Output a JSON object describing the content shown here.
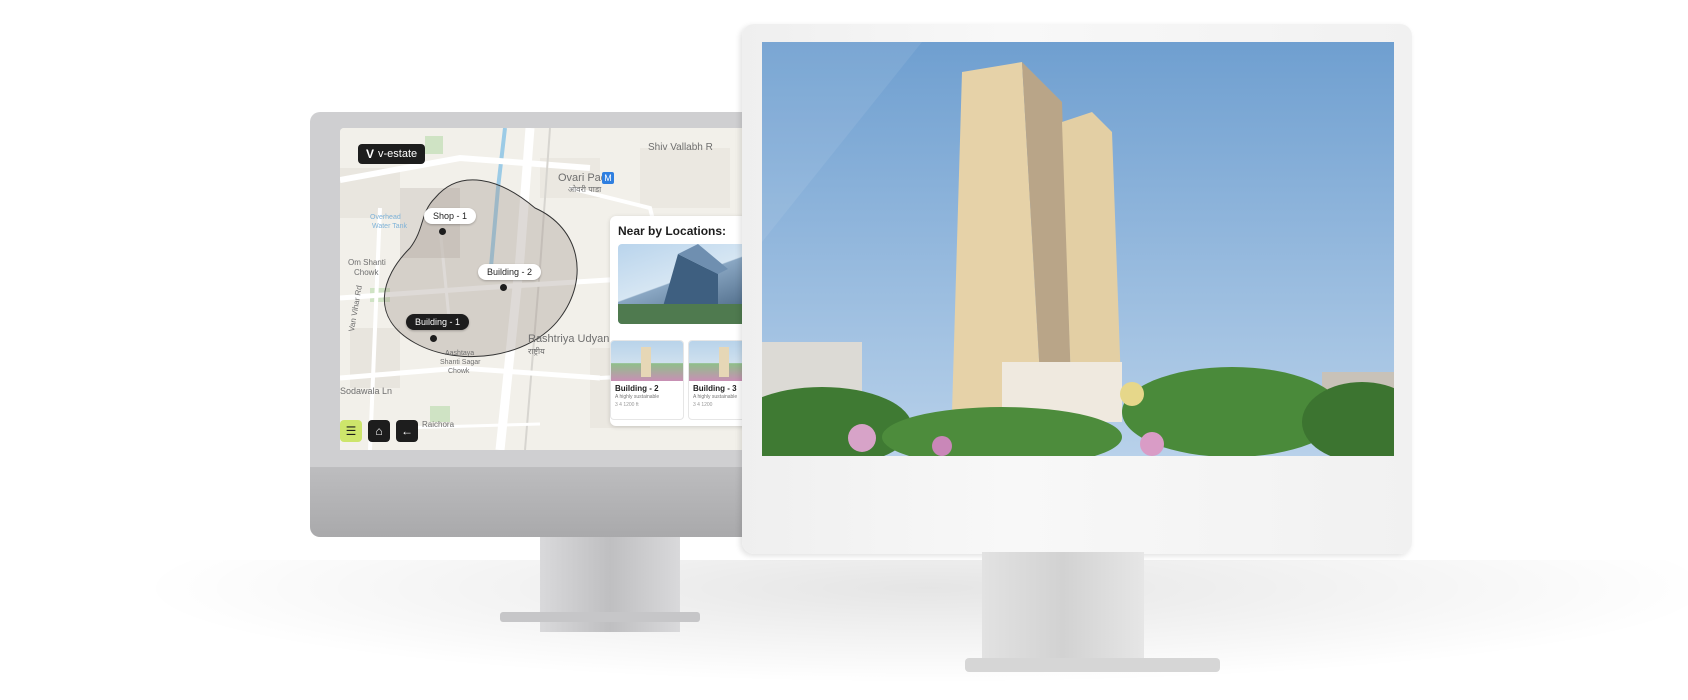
{
  "brand": {
    "logo_mark": "V",
    "name": "v-estate"
  },
  "map": {
    "labels": {
      "shiv_vallabh": "Shiv Vallabh R",
      "ovari_pada": "Ovari Pada",
      "ovari_pada_hindi": "ओवरी पाडा",
      "metro_marker": "M",
      "om_shanti": "Om Shanti",
      "om_shanti_chowk": "Chowk",
      "rashtriya": "Rashtriya Udyan",
      "rashtriya_hindi": "राष्ट्रीय",
      "ashtavinayak_1": "Aashtaya",
      "ashtavinayak_2": "Shanti Sagar",
      "ashtavinayak_3": "Chowk",
      "sodawala": "Sodawala Ln",
      "raichora": "Raichora",
      "van_vihar": "Van Vihar Rd",
      "overhead_tank": "Overhead",
      "overhead_tank_2": "Water Tank"
    },
    "pins": {
      "shop1": "Shop - 1",
      "building2": "Building - 2",
      "building1": "Building - 1"
    },
    "controls": {
      "menu_icon": "menu-icon",
      "home_icon": "home-icon",
      "back_icon": "back-arrow-icon",
      "menu_glyph": "☰",
      "home_glyph": "⌂",
      "back_glyph": "←"
    }
  },
  "nearby": {
    "title": "Near by Locations:",
    "cards": [
      {
        "title": "Building - 2",
        "subtitle": "A highly sustainable",
        "meta": "3   4   1200 ft"
      },
      {
        "title": "Building - 3",
        "subtitle": "A highly sustainable",
        "meta": "3   4   1200"
      }
    ]
  },
  "colors": {
    "accent": "#cde56b",
    "dark": "#1d1d1d",
    "sky": "#7fa9d6"
  }
}
